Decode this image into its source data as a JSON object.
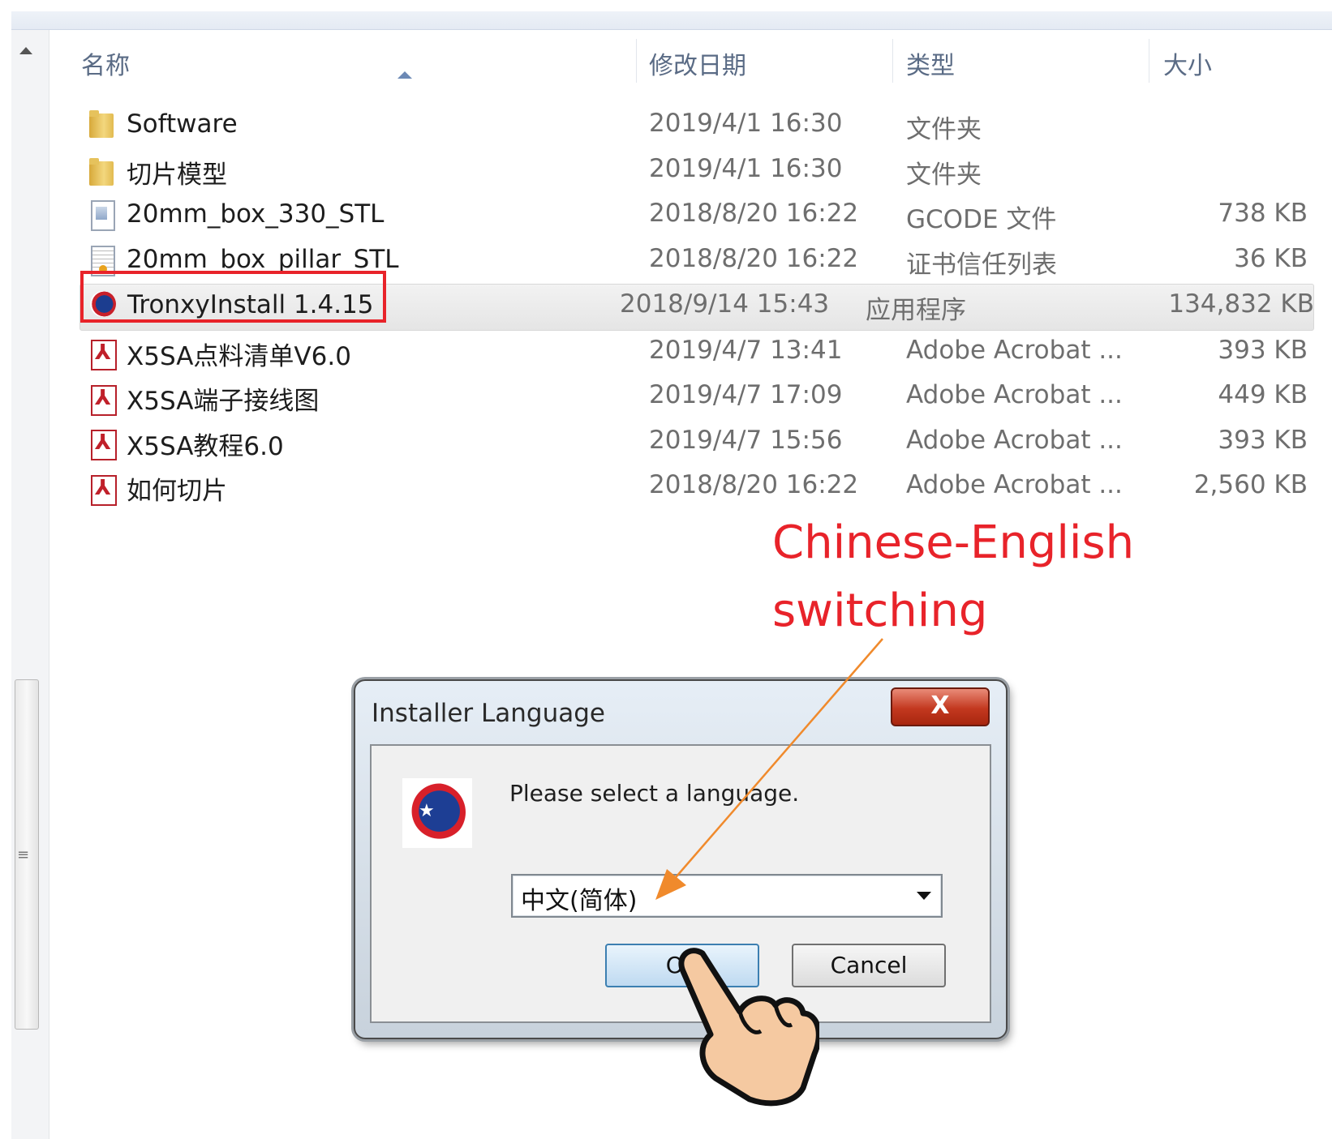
{
  "columns": {
    "name": "名称",
    "modified": "修改日期",
    "type": "类型",
    "size": "大小"
  },
  "files": [
    {
      "icon": "folder-icon",
      "name": "Software",
      "modified": "2019/4/1 16:30",
      "type": "文件夹",
      "size": ""
    },
    {
      "icon": "folder-icon",
      "name": "切片模型",
      "modified": "2019/4/1 16:30",
      "type": "文件夹",
      "size": ""
    },
    {
      "icon": "gcode-file-icon",
      "name": "20mm_box_330_STL",
      "modified": "2018/8/20 16:22",
      "type": "GCODE 文件",
      "size": "738 KB"
    },
    {
      "icon": "certificate-file-icon",
      "name": "20mm_box_pillar_STL",
      "modified": "2018/8/20 16:22",
      "type": "证书信任列表",
      "size": "36 KB"
    },
    {
      "icon": "installer-app-icon",
      "name": "TronxyInstall 1.4.15",
      "modified": "2018/9/14 15:43",
      "type": "应用程序",
      "size": "134,832 KB",
      "selected": true
    },
    {
      "icon": "pdf-file-icon",
      "name": "X5SA点料清单V6.0",
      "modified": "2019/4/7 13:41",
      "type": "Adobe Acrobat ...",
      "size": "393 KB"
    },
    {
      "icon": "pdf-file-icon",
      "name": "X5SA端子接线图",
      "modified": "2019/4/7 17:09",
      "type": "Adobe Acrobat ...",
      "size": "449 KB"
    },
    {
      "icon": "pdf-file-icon",
      "name": "X5SA教程6.0",
      "modified": "2019/4/7 15:56",
      "type": "Adobe Acrobat ...",
      "size": "393 KB"
    },
    {
      "icon": "pdf-file-icon",
      "name": "如何切片",
      "modified": "2018/8/20 16:22",
      "type": "Adobe Acrobat ...",
      "size": "2,560 KB"
    }
  ],
  "annotation": {
    "line1": "Chinese-English",
    "line2": "switching",
    "color": "#e8232a"
  },
  "dialog": {
    "title": "Installer Language",
    "close_label": "X",
    "message": "Please select a language.",
    "selected_language": "中文(简体)",
    "ok_label": "OK",
    "cancel_label": "Cancel"
  },
  "colors": {
    "highlight": "#e8232a",
    "arrow": "#f08a2c",
    "header_text": "#5a6b85"
  }
}
